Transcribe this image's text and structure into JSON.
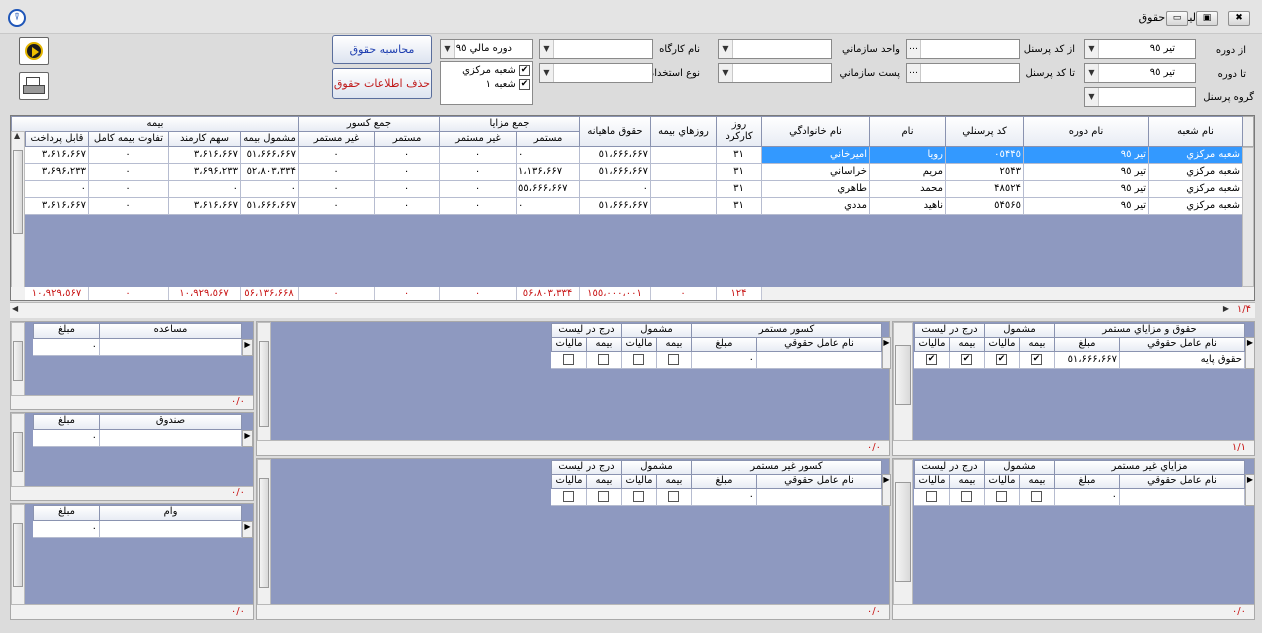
{
  "window": {
    "title": "ليست حقوق",
    "btn_min": "▭",
    "btn_max": "▣",
    "btn_close": "✖",
    "app_icon": "⍒"
  },
  "filters": {
    "from_period_label": "از دوره",
    "from_period_value": "تير ٩٥",
    "to_period_label": "تا دوره",
    "to_period_value": "تير ٩٥",
    "group_label": "گروه پرسنل",
    "group_value": "",
    "from_code_label": "از کد پرسنل",
    "from_code_value": "",
    "to_code_label": "تا کد پرسنل",
    "to_code_value": "",
    "org_unit_label": "واحد سازماني",
    "org_unit_value": "",
    "org_post_label": "پست سازماني",
    "org_post_value": "",
    "workshop_label": "نام کارگاه",
    "workshop_value": "",
    "employment_label": "نوع استخدام",
    "employment_value": "",
    "fiscal_label": "دوره مالي ٩٥",
    "branches": [
      "شعبه مرکزي",
      "شعبه ١"
    ],
    "calc_button": "محاسبه حقوق",
    "delete_button": "حذف اطلاعات حقوق"
  },
  "main_grid": {
    "group_headers": {
      "insurance": "بيمه",
      "deductions": "جمع کسور",
      "benefits": "جمع مزايا"
    },
    "columns": {
      "branch": "نام شعبه",
      "period": "نام دوره",
      "code": "کد پرسنلي",
      "name": "نام",
      "family": "نام خانوادگي",
      "days": "روز کارکرد",
      "ins_days": "روزهاي بيمه",
      "salary": "حقوق ماهيانه",
      "ben_cont": "مستمر",
      "ben_noncont": "غير مستمر",
      "ded_cont": "مستمر",
      "ded_noncont": "غير مستمر",
      "ins_subject": "مشمول بيمه",
      "emp_share": "سهم کارمند",
      "full_diff": "تفاوت بيمه کامل",
      "payable": "قابل پرداخت"
    },
    "rows": [
      {
        "branch": "شعبه مرکزي",
        "period": "تير ٩٥",
        "code": "٠٥۴۴٥",
        "name": "رويا",
        "family": "اميرخاني",
        "days": "٣١",
        "ins_days": "",
        "salary": "٥١،۶۶۶،۶۶٧",
        "ben_cont": "٠",
        "ben_noncont": "٠",
        "ded_cont": "٠",
        "ded_noncont": "٠",
        "ins_subject": "٥١،۶۶۶،۶۶٧",
        "emp_share": "٣،۶١۶،۶۶٧",
        "full_diff": "٠",
        "payable": "٣،۶١۶،۶۶٧"
      },
      {
        "branch": "شعبه مرکزي",
        "period": "تير ٩٥",
        "code": "٢٥۴٣",
        "name": "مريم",
        "family": "خراساني",
        "days": "٣١",
        "ins_days": "",
        "salary": "٥١،۶۶۶،۶۶٧",
        "ben_cont": "١،١٣۶،۶۶٧",
        "ben_noncont": "٠",
        "ded_cont": "٠",
        "ded_noncont": "٠",
        "ins_subject": "٥٢،٨٠٣،٣٣۴",
        "emp_share": "٣،۶٩۶،٢٣٣",
        "full_diff": "٠",
        "payable": "٣،۶٩۶،٢٣٣"
      },
      {
        "branch": "شعبه مرکزي",
        "period": "تير ٩٥",
        "code": "۴٨٥٢۴",
        "name": "محمد",
        "family": "طاهري",
        "days": "٣١",
        "ins_days": "",
        "salary": "٠",
        "ben_cont": "٥٥،۶۶۶،۶۶٧",
        "ben_noncont": "٠",
        "ded_cont": "٠",
        "ded_noncont": "٠",
        "ins_subject": "٠",
        "emp_share": "٠",
        "full_diff": "٠",
        "payable": "٠"
      },
      {
        "branch": "شعبه مرکزي",
        "period": "تير ٩٥",
        "code": "٥۴٥۶٥",
        "name": "ناهيد",
        "family": "مددي",
        "days": "٣١",
        "ins_days": "",
        "salary": "٥١،۶۶۶،۶۶٧",
        "ben_cont": "٠",
        "ben_noncont": "٠",
        "ded_cont": "٠",
        "ded_noncont": "٠",
        "ins_subject": "٥١،۶۶۶،۶۶٧",
        "emp_share": "٣،۶١۶،۶۶٧",
        "full_diff": "٠",
        "payable": "٣،۶١۶،۶۶٧"
      }
    ],
    "totals": {
      "days": "١٢۴",
      "ins_days": "٠",
      "salary": "١٥٥،٠٠٠،٠٠١",
      "ben_cont": "٥۶،٨٠٣،٣٣۴",
      "ben_noncont": "٠",
      "ded_cont": "٠",
      "ded_noncont": "٠",
      "ins_subject": "٥۶،١٣۶،۶۶٨",
      "emp_share": "١٠،٩٢٩،٥۶٧",
      "full_diff": "٠",
      "payable": "١٠،٩٢٩،٥۶٧"
    },
    "record_count": "١/۴"
  },
  "panels": {
    "benefits": {
      "title": "حقوق و مزاياي مستمر",
      "subject": "مشمول",
      "list": "درج در ليست",
      "col_name": "نام عامل حقوقي",
      "col_amount": "مبلغ",
      "col_ins": "بيمه",
      "col_tax": "ماليات",
      "row_name": "حقوق پايه",
      "row_amount": "٥١،۶۶۶،۶۶٧",
      "count": "١/١"
    },
    "deductions": {
      "title": "کسور مستمر",
      "subject": "مشمول",
      "list": "درج در ليست",
      "col_name": "نام عامل حقوقي",
      "col_amount": "مبلغ",
      "col_ins": "بيمه",
      "col_tax": "ماليات",
      "row_amount": "٠",
      "count": "٠/٠"
    },
    "help": {
      "title": "مساعده",
      "col_amount": "مبلغ",
      "row_amount": "٠",
      "count": "٠/٠"
    },
    "fund": {
      "title": "صندوق",
      "col_amount": "مبلغ",
      "row_amount": "٠",
      "count": "٠/٠"
    },
    "noncont_benefits": {
      "title": "مزاياي غير مستمر",
      "subject": "مشمول",
      "list": "درج در ليست",
      "col_name": "نام عامل حقوقي",
      "col_amount": "مبلغ",
      "col_ins": "بيمه",
      "col_tax": "ماليات",
      "row_amount": "٠",
      "count": "٠/٠"
    },
    "noncont_deductions": {
      "title": "کسور غير مستمر",
      "subject": "مشمول",
      "list": "درج در ليست",
      "col_name": "نام عامل حقوقي",
      "col_amount": "مبلغ",
      "col_ins": "بيمه",
      "col_tax": "ماليات",
      "row_amount": "٠",
      "count": "٠/٠"
    },
    "loan": {
      "title": "وام",
      "col_amount": "مبلغ",
      "row_amount": "٠",
      "count": "٠/٠"
    }
  }
}
